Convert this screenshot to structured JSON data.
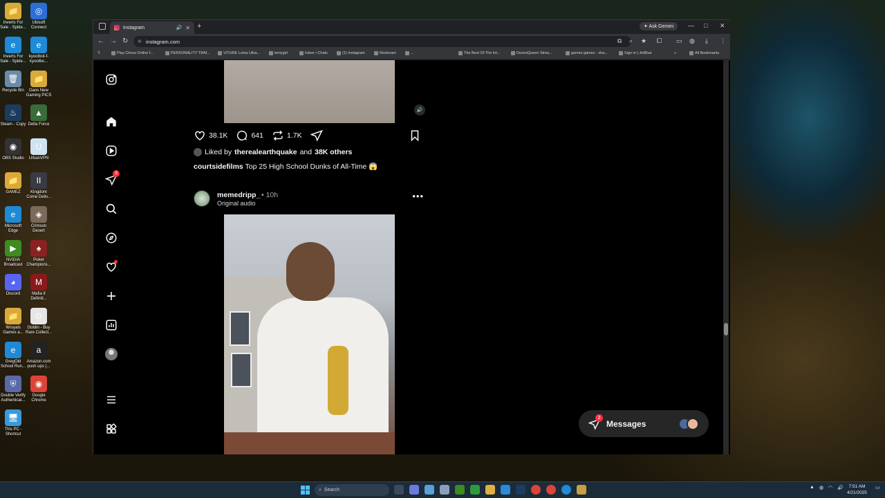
{
  "desktop": {
    "icons": [
      {
        "label": "Inverts For Sale - Spide...",
        "glyph": "📁",
        "color": "#d9a93b"
      },
      {
        "label": "Ubisoft Connect",
        "glyph": "◎",
        "color": "#2b6fd6"
      },
      {
        "label": "Inverts For Sale - Spide...",
        "glyph": "e",
        "color": "#1f8ad6"
      },
      {
        "label": "kyootbot-f-kyootbo...",
        "glyph": "e",
        "color": "#1f8ad6"
      },
      {
        "label": "Recycle Bin",
        "glyph": "🗑",
        "color": "#6b8aa8"
      },
      {
        "label": "Dans New Gaming PICS",
        "glyph": "📁",
        "color": "#d9a93b"
      },
      {
        "label": "Steam - Copy",
        "glyph": "♨",
        "color": "#1b3c5e"
      },
      {
        "label": "Delta Force",
        "glyph": "▲",
        "color": "#3a6b3a"
      },
      {
        "label": "OBS Studio",
        "glyph": "◉",
        "color": "#333333"
      },
      {
        "label": "UrbanVPN",
        "glyph": "U",
        "color": "#cfe3f2"
      },
      {
        "label": "GAMEZ",
        "glyph": "📁",
        "color": "#d9a93b"
      },
      {
        "label": "Kingdom Come Deliv...",
        "glyph": "II",
        "color": "#3a3a44"
      },
      {
        "label": "Microsoft Edge",
        "glyph": "e",
        "color": "#1f8ad6"
      },
      {
        "label": "Crimson Desert",
        "glyph": "◈",
        "color": "#7a6a5a"
      },
      {
        "label": "NVIDIA Broadcast",
        "glyph": "▶",
        "color": "#3f8a21"
      },
      {
        "label": "Poker Champions...",
        "glyph": "♠",
        "color": "#8a2222"
      },
      {
        "label": "Discord",
        "glyph": "◕",
        "color": "#5865f2"
      },
      {
        "label": "Mafia II Definiti...",
        "glyph": "M",
        "color": "#8a1a1a"
      },
      {
        "label": "Wroyals Games a...",
        "glyph": "📁",
        "color": "#d9a93b"
      },
      {
        "label": "Goldin - Buy Rare Collect...",
        "glyph": "G",
        "color": "#e6e6e6"
      },
      {
        "label": "GregOld School Run...",
        "glyph": "e",
        "color": "#1f8ad6"
      },
      {
        "label": "Amazon.com push ups (...",
        "glyph": "a",
        "color": "#222222"
      },
      {
        "label": "Double Verify Authenticat...",
        "glyph": "⛨",
        "color": "#5a6aa8"
      },
      {
        "label": "Google Chrome",
        "glyph": "◉",
        "color": "#db4437"
      },
      {
        "label": "This PC - Shortcut",
        "glyph": "🖥",
        "color": "#3a9ad9"
      }
    ]
  },
  "browser": {
    "tab_title": "Instagram",
    "new_tab": "+",
    "ask_gemini": "Ask Gemini",
    "url_prefix": "⊕",
    "url": "instagram.com",
    "bookmarks": [
      "Play Chess Online f...",
      "PERSONALITY TRAI...",
      "VITURE Luma Ultra...",
      "lentygirl",
      "Inbox • Chats",
      "(1) Instagram",
      "Restream",
      "...",
      "The Best Of The Int...",
      "DezenQueen Strea...",
      "games games - sha...",
      "Sign in | JetBlue",
      "»",
      "All Bookmarks"
    ]
  },
  "instagram": {
    "notification_count": "3",
    "post1": {
      "likes": "38.1K",
      "comments": "641",
      "reposts": "1.7K",
      "liked_by_prefix": "Liked by",
      "liked_by_user": "therealearthquake",
      "liked_by_and": "and",
      "liked_by_others": "38K others",
      "caption_user": "courtsidefilms",
      "caption_text": "Top 25 High School Dunks of All-Time 😱"
    },
    "post2": {
      "username": "memedripp_",
      "time": "• 10h",
      "audio": "Original audio",
      "more": "•••"
    },
    "messages": {
      "label": "Messages",
      "badge": "2"
    }
  },
  "taskbar": {
    "search_placeholder": "Search",
    "time": "7:51 AM",
    "date": "4/21/2025"
  },
  "colors": {
    "notification_red": "#ff3040",
    "ig_background": "#000000",
    "chrome_dark": "#202124"
  }
}
